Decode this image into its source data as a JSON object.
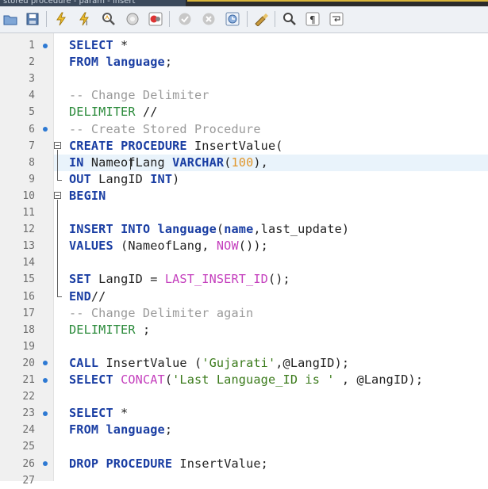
{
  "window": {
    "title": "stored procedure - param - insert"
  },
  "toolbar": {
    "icons": [
      "folder-open-icon",
      "save-icon",
      "execute-icon",
      "execute-selection-icon",
      "explain-icon",
      "stop-icon",
      "stop-on-error-icon",
      "commit-icon",
      "rollback-icon",
      "autocommit-icon",
      "beautify-icon",
      "find-icon",
      "invisible-chars-icon",
      "word-wrap-icon"
    ]
  },
  "editor": {
    "current_line": 8,
    "lines": [
      {
        "n": "1",
        "bp": true,
        "tokens": [
          [
            "kw",
            "SELECT"
          ],
          [
            "ident",
            " *"
          ]
        ]
      },
      {
        "n": "2",
        "bp": false,
        "tokens": [
          [
            "kw",
            "FROM"
          ],
          [
            "ident",
            " "
          ],
          [
            "kw",
            "language"
          ],
          [
            "ident",
            ";"
          ]
        ]
      },
      {
        "n": "3",
        "bp": false,
        "tokens": []
      },
      {
        "n": "4",
        "bp": false,
        "tokens": [
          [
            "cm",
            "-- Change Delimiter"
          ]
        ]
      },
      {
        "n": "5",
        "bp": false,
        "tokens": [
          [
            "dl",
            "DELIMITER"
          ],
          [
            "ident",
            " //"
          ]
        ]
      },
      {
        "n": "6",
        "bp": true,
        "tokens": [
          [
            "cm",
            "-- Create Stored Procedure"
          ]
        ]
      },
      {
        "n": "7",
        "bp": false,
        "tokens": [
          [
            "kw",
            "CREATE"
          ],
          [
            "ident",
            " "
          ],
          [
            "kw",
            "PROCEDURE"
          ],
          [
            "ident",
            " InsertValue("
          ]
        ]
      },
      {
        "n": "8",
        "bp": false,
        "tokens": [
          [
            "kw",
            "IN"
          ],
          [
            "ident",
            " NameofLang "
          ],
          [
            "kw",
            "VARCHAR"
          ],
          [
            "ident",
            "("
          ],
          [
            "num",
            "100"
          ],
          [
            "ident",
            "),"
          ]
        ]
      },
      {
        "n": "9",
        "bp": false,
        "tokens": [
          [
            "kw",
            "OUT"
          ],
          [
            "ident",
            " LangID "
          ],
          [
            "kw",
            "INT"
          ],
          [
            "ident",
            ")"
          ]
        ]
      },
      {
        "n": "10",
        "bp": false,
        "tokens": [
          [
            "kw",
            "BEGIN"
          ]
        ]
      },
      {
        "n": "11",
        "bp": false,
        "tokens": []
      },
      {
        "n": "12",
        "bp": false,
        "tokens": [
          [
            "kw",
            "INSERT"
          ],
          [
            "ident",
            " "
          ],
          [
            "kw",
            "INTO"
          ],
          [
            "ident",
            " "
          ],
          [
            "kw",
            "language"
          ],
          [
            "ident",
            "("
          ],
          [
            "kw",
            "name"
          ],
          [
            "ident",
            ",last_update)"
          ]
        ]
      },
      {
        "n": "13",
        "bp": false,
        "tokens": [
          [
            "kw",
            "VALUES"
          ],
          [
            "ident",
            " (NameofLang, "
          ],
          [
            "fn",
            "NOW"
          ],
          [
            "ident",
            "());"
          ]
        ]
      },
      {
        "n": "14",
        "bp": false,
        "tokens": []
      },
      {
        "n": "15",
        "bp": false,
        "tokens": [
          [
            "kw",
            "SET"
          ],
          [
            "ident",
            " LangID = "
          ],
          [
            "fn",
            "LAST_INSERT_ID"
          ],
          [
            "ident",
            "();"
          ]
        ]
      },
      {
        "n": "16",
        "bp": false,
        "tokens": [
          [
            "kw",
            "END"
          ],
          [
            "ident",
            "//"
          ]
        ]
      },
      {
        "n": "17",
        "bp": false,
        "tokens": [
          [
            "cm",
            "-- Change Delimiter again"
          ]
        ]
      },
      {
        "n": "18",
        "bp": false,
        "tokens": [
          [
            "dl",
            "DELIMITER"
          ],
          [
            "ident",
            " ;"
          ]
        ]
      },
      {
        "n": "19",
        "bp": false,
        "tokens": []
      },
      {
        "n": "20",
        "bp": true,
        "tokens": [
          [
            "kw",
            "CALL"
          ],
          [
            "ident",
            " InsertValue ("
          ],
          [
            "str",
            "'Gujarati'"
          ],
          [
            "ident",
            ",@LangID);"
          ]
        ]
      },
      {
        "n": "21",
        "bp": true,
        "tokens": [
          [
            "kw",
            "SELECT"
          ],
          [
            "ident",
            " "
          ],
          [
            "fn",
            "CONCAT"
          ],
          [
            "ident",
            "("
          ],
          [
            "str",
            "'Last Language_ID is '"
          ],
          [
            "ident",
            " , @LangID);"
          ]
        ]
      },
      {
        "n": "22",
        "bp": false,
        "tokens": []
      },
      {
        "n": "23",
        "bp": true,
        "tokens": [
          [
            "kw",
            "SELECT"
          ],
          [
            "ident",
            " *"
          ]
        ]
      },
      {
        "n": "24",
        "bp": false,
        "tokens": [
          [
            "kw",
            "FROM"
          ],
          [
            "ident",
            " "
          ],
          [
            "kw",
            "language"
          ],
          [
            "ident",
            ";"
          ]
        ]
      },
      {
        "n": "25",
        "bp": false,
        "tokens": []
      },
      {
        "n": "26",
        "bp": true,
        "tokens": [
          [
            "kw",
            "DROP"
          ],
          [
            "ident",
            " "
          ],
          [
            "kw",
            "PROCEDURE"
          ],
          [
            "ident",
            " InsertValue;"
          ]
        ]
      },
      {
        "n": "27",
        "bp": false,
        "tokens": []
      }
    ]
  }
}
